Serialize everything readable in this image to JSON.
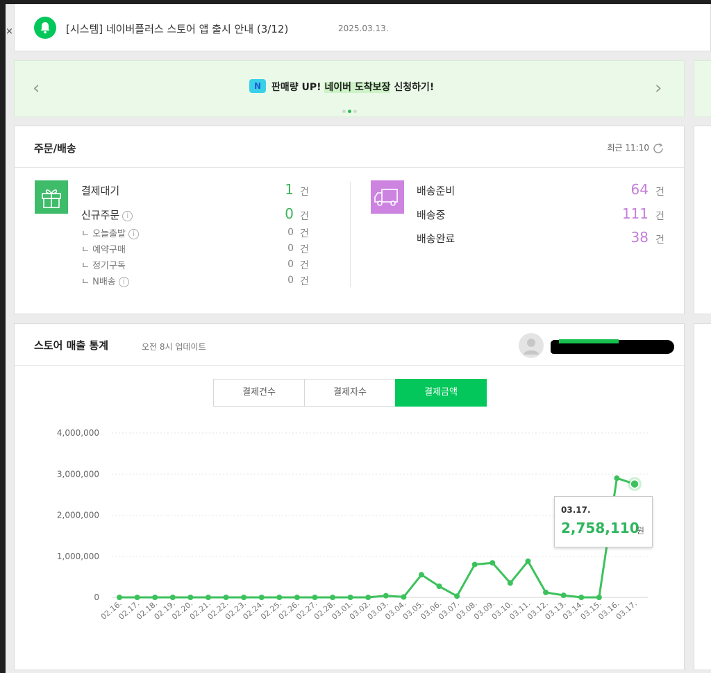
{
  "notice": {
    "title": "[시스템] 네이버플러스 스토어 앱 출시 안내 (3/12)",
    "date": "2025.03.13."
  },
  "banner": {
    "badge": "N",
    "text_before": "판매량 UP! ",
    "text_highlight": "네이버 도착보장",
    "text_after": " 신청하기!",
    "prev": "‹",
    "next": "›"
  },
  "orders": {
    "title": "주문/배송",
    "refreshed": "최근 11:10",
    "unit": "건",
    "left": {
      "pending_label": "결제대기",
      "pending_value": "1",
      "new_label": "신규주문",
      "new_value": "0",
      "sub_items": [
        {
          "label": "오늘출발",
          "value": "0",
          "info": true
        },
        {
          "label": "예약구매",
          "value": "0",
          "info": false
        },
        {
          "label": "정기구독",
          "value": "0",
          "info": false
        },
        {
          "label": "N배송",
          "value": "0",
          "info": true
        }
      ]
    },
    "right": [
      {
        "label": "배송준비",
        "value": "64"
      },
      {
        "label": "배송중",
        "value": "111"
      },
      {
        "label": "배송완료",
        "value": "38"
      }
    ],
    "colors": {
      "green": "#39b55a",
      "purple": "#c47ed9",
      "gift_bg": "#3fbc6a",
      "truck_bg": "#cc84e0"
    }
  },
  "stats": {
    "title": "스토어 매출 통계",
    "update": "오전 8시 업데이트",
    "tabs": [
      "결제건수",
      "결제자수",
      "결제금액"
    ],
    "active_tab": 2,
    "tooltip": {
      "date": "03.17.",
      "value": "2,758,110",
      "unit": "원"
    }
  },
  "chart_data": {
    "type": "line",
    "title": "",
    "xlabel": "",
    "ylabel": "",
    "ylim": [
      0,
      4000000
    ],
    "yticks": [
      "4,000,000",
      "3,000,000",
      "2,000,000",
      "1,000,000",
      "0"
    ],
    "ytick_values": [
      4000000,
      3000000,
      2000000,
      1000000,
      0
    ],
    "grid": true,
    "color": "#3cc25c",
    "categories": [
      "02.16.",
      "02.17.",
      "02.18.",
      "02.19.",
      "02.20.",
      "02.21.",
      "02.22.",
      "02.23.",
      "02.24.",
      "02.25.",
      "02.26.",
      "02.27.",
      "02.28.",
      "03.01.",
      "03.02.",
      "03.03.",
      "03.04.",
      "03.05.",
      "03.06.",
      "03.07.",
      "03.08.",
      "03.09.",
      "03.10.",
      "03.11.",
      "03.12.",
      "03.13.",
      "03.14.",
      "03.15.",
      "03.16.",
      "03.17."
    ],
    "values": [
      0,
      0,
      0,
      0,
      0,
      0,
      0,
      0,
      0,
      0,
      0,
      0,
      0,
      0,
      0,
      40000,
      10000,
      550000,
      270000,
      30000,
      800000,
      840000,
      350000,
      880000,
      120000,
      50000,
      0,
      0,
      2900000,
      2758110
    ]
  }
}
